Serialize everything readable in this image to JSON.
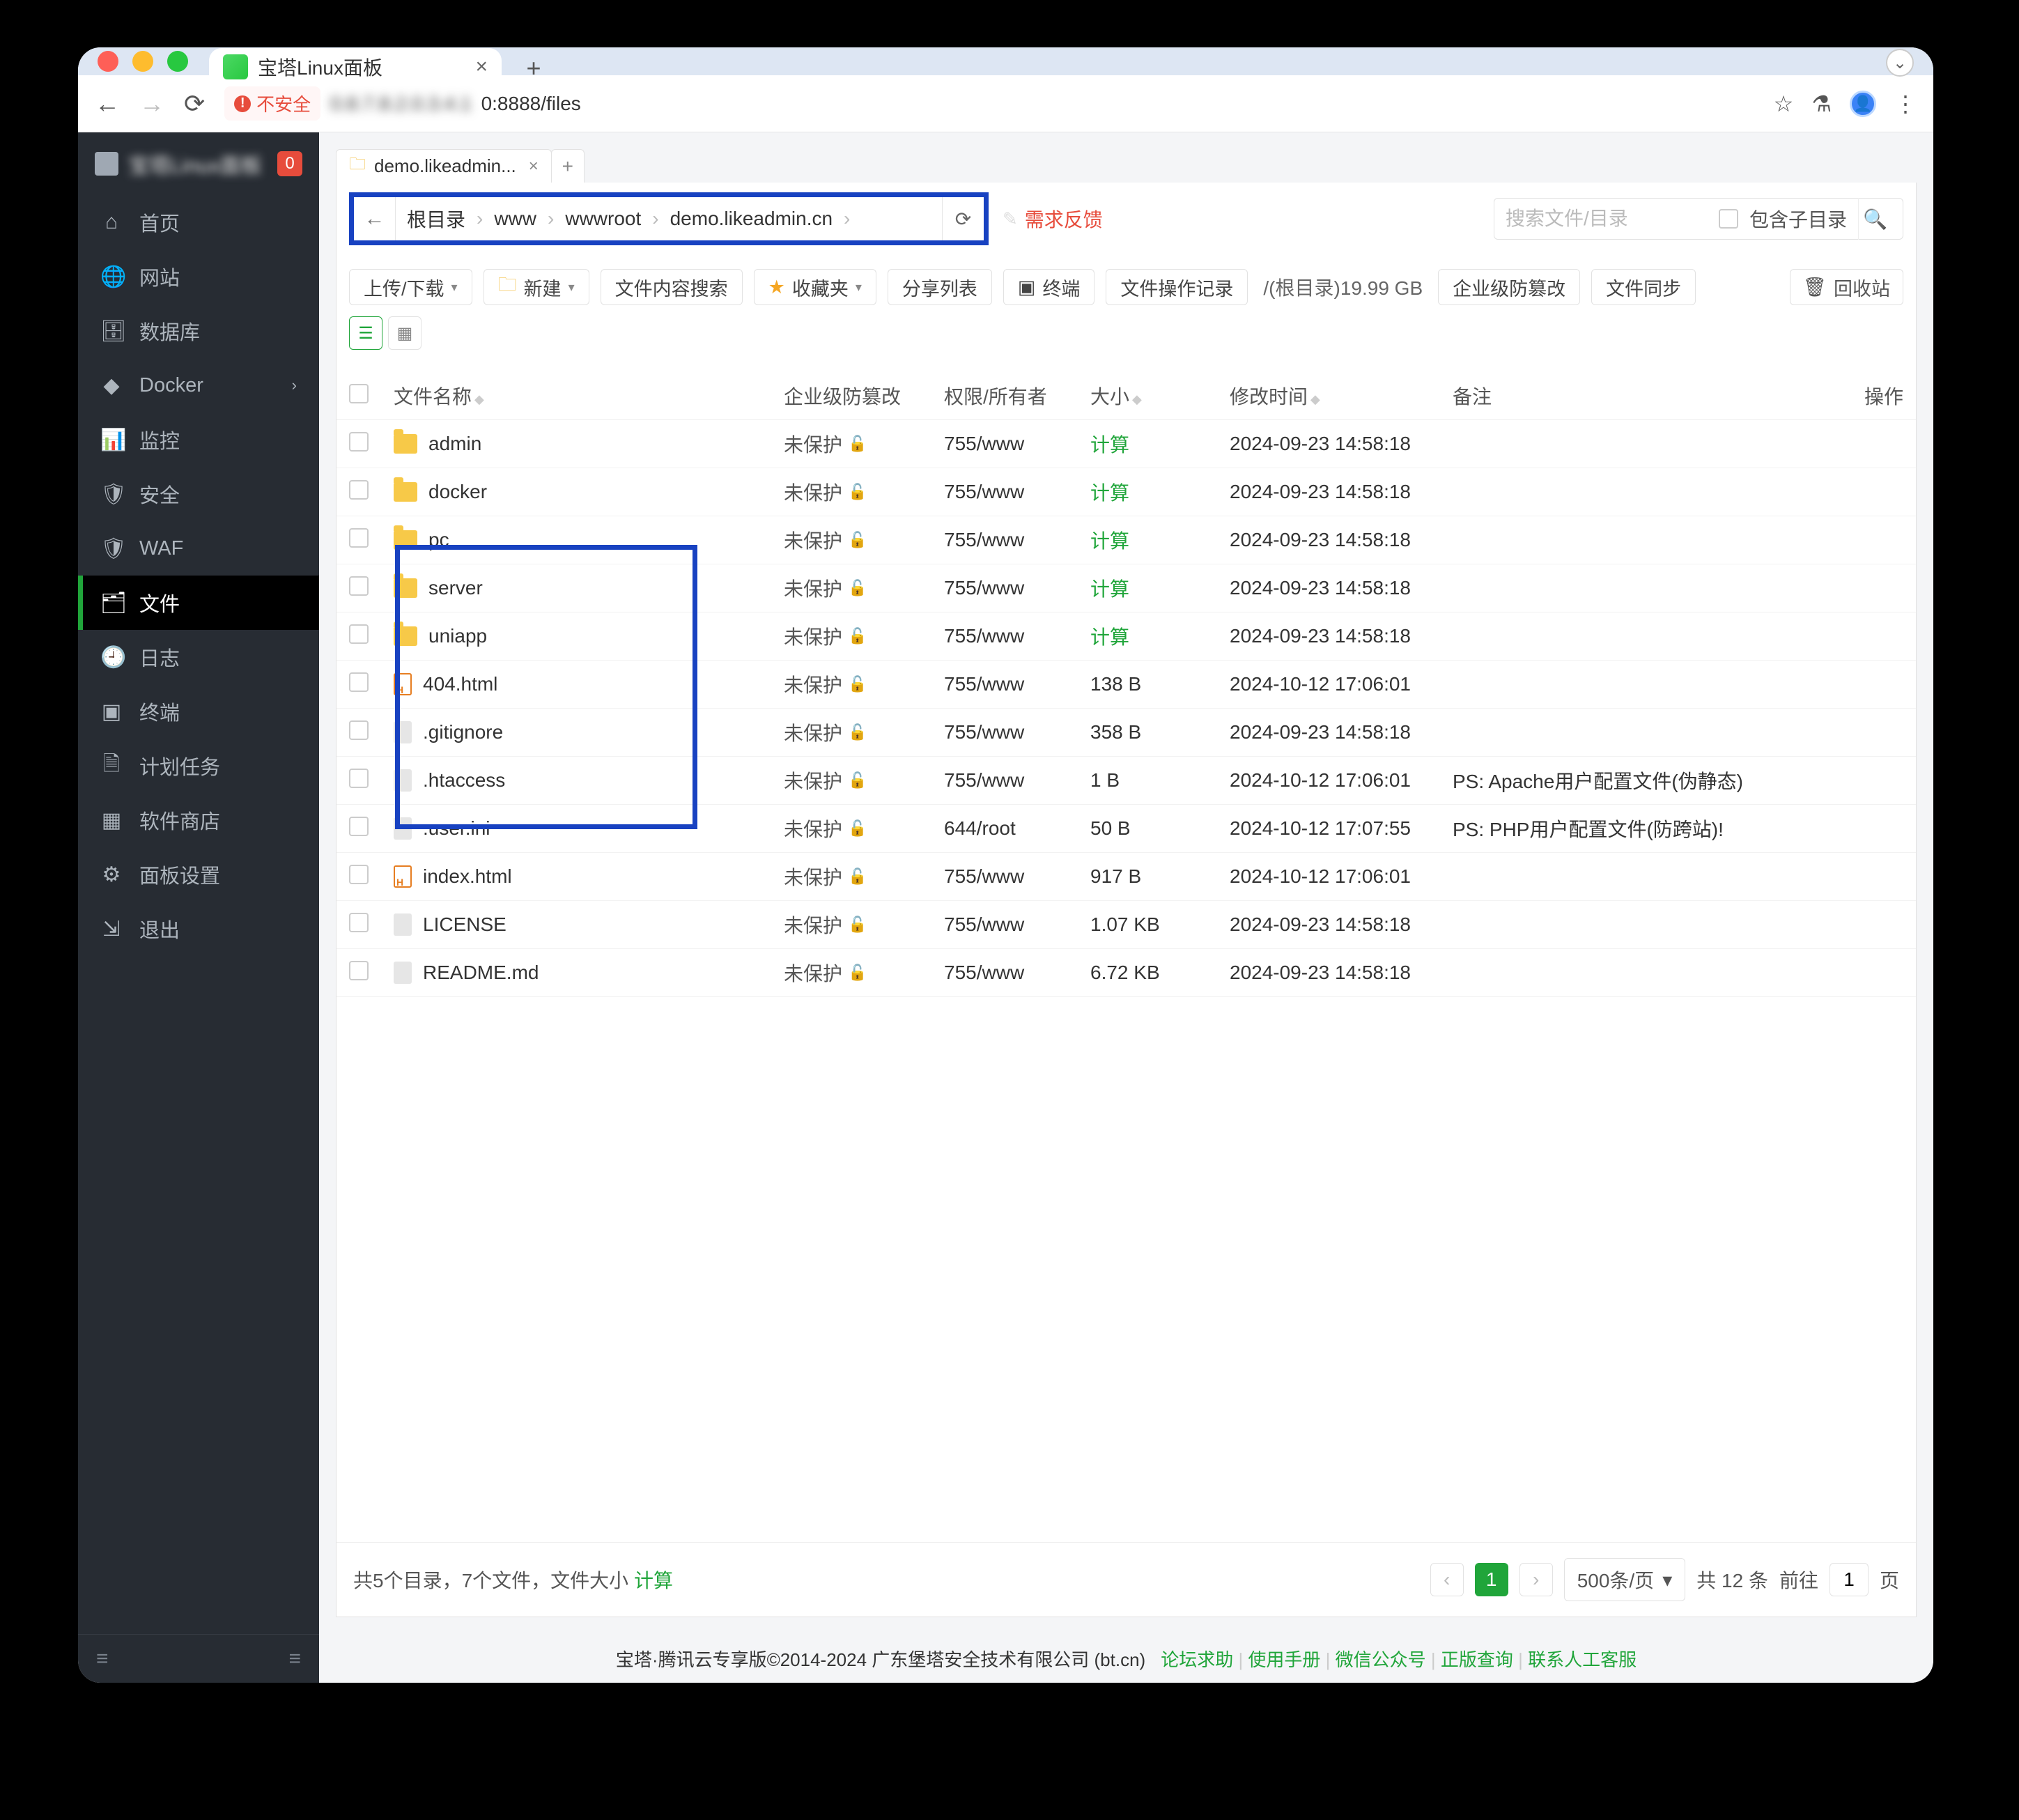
{
  "browser": {
    "tab_title": "宝塔Linux面板",
    "url_insecure": "不安全",
    "url_host_blur": "0.8.7.8.2.0.3.4.1",
    "url_rest": "0:8888/files",
    "new_tab": "+",
    "close": "×",
    "ext": "⌄"
  },
  "sidebar": {
    "brand": "宝塔Linux面板",
    "badge": "0",
    "items": [
      {
        "icon": "⌂",
        "label": "首页",
        "k": "home"
      },
      {
        "icon": "🌐",
        "label": "网站",
        "k": "site"
      },
      {
        "icon": "🗄",
        "label": "数据库",
        "k": "db"
      },
      {
        "icon": "◆",
        "label": "Docker",
        "k": "docker",
        "chev": true
      },
      {
        "icon": "📊",
        "label": "监控",
        "k": "mon"
      },
      {
        "icon": "🛡",
        "label": "安全",
        "k": "sec"
      },
      {
        "icon": "🛡",
        "label": "WAF",
        "k": "waf"
      },
      {
        "icon": "🗂",
        "label": "文件",
        "k": "files",
        "active": true
      },
      {
        "icon": "🕘",
        "label": "日志",
        "k": "log"
      },
      {
        "icon": "▣",
        "label": "终端",
        "k": "term"
      },
      {
        "icon": "🗎",
        "label": "计划任务",
        "k": "cron"
      },
      {
        "icon": "▦",
        "label": "软件商店",
        "k": "store"
      },
      {
        "icon": "⚙",
        "label": "面板设置",
        "k": "set"
      },
      {
        "icon": "⇲",
        "label": "退出",
        "k": "exit"
      }
    ],
    "footer_left": "≡",
    "footer_right": "≡"
  },
  "pathTab": {
    "label": "demo.likeadmin...",
    "close": "×",
    "add": "+"
  },
  "breadcrumb": {
    "back": "←",
    "parts": [
      "根目录",
      "www",
      "wwwroot",
      "demo.likeadmin.cn"
    ],
    "sep": "›",
    "reload": "⟳"
  },
  "feedback": {
    "icon": "✎",
    "text": "需求反馈"
  },
  "search": {
    "placeholder": "搜索文件/目录",
    "sub": "包含子目录",
    "icon": "🔍"
  },
  "toolbar": {
    "upload": "上传/下载",
    "new": "新建",
    "content_search": "文件内容搜索",
    "fav": "收藏夹",
    "share": "分享列表",
    "terminal": "终端",
    "oplog": "文件操作记录",
    "usage": "/(根目录)19.99 GB",
    "tamper": "企业级防篡改",
    "sync": "文件同步",
    "recycle": "回收站",
    "caret": "▾",
    "term_icon": "▣",
    "trash_icon": "🗑",
    "list_icon": "☰",
    "grid_icon": "▦"
  },
  "columns": {
    "name": "文件名称",
    "tamper": "企业级防篡改",
    "perm": "权限/所有者",
    "size": "大小",
    "mtime": "修改时间",
    "remark": "备注",
    "ops": "操作"
  },
  "rows": [
    {
      "type": "folder",
      "name": "admin",
      "tamper": "未保护",
      "perm": "755/www",
      "size": "计算",
      "size_calc": true,
      "mtime": "2024-09-23 14:58:18",
      "remark": ""
    },
    {
      "type": "folder",
      "name": "docker",
      "tamper": "未保护",
      "perm": "755/www",
      "size": "计算",
      "size_calc": true,
      "mtime": "2024-09-23 14:58:18",
      "remark": ""
    },
    {
      "type": "folder",
      "name": "pc",
      "tamper": "未保护",
      "perm": "755/www",
      "size": "计算",
      "size_calc": true,
      "mtime": "2024-09-23 14:58:18",
      "remark": ""
    },
    {
      "type": "folder",
      "name": "server",
      "tamper": "未保护",
      "perm": "755/www",
      "size": "计算",
      "size_calc": true,
      "mtime": "2024-09-23 14:58:18",
      "remark": ""
    },
    {
      "type": "folder",
      "name": "uniapp",
      "tamper": "未保护",
      "perm": "755/www",
      "size": "计算",
      "size_calc": true,
      "mtime": "2024-09-23 14:58:18",
      "remark": ""
    },
    {
      "type": "html",
      "name": "404.html",
      "tamper": "未保护",
      "perm": "755/www",
      "size": "138 B",
      "size_calc": false,
      "mtime": "2024-10-12 17:06:01",
      "remark": ""
    },
    {
      "type": "file",
      "name": ".gitignore",
      "tamper": "未保护",
      "perm": "755/www",
      "size": "358 B",
      "size_calc": false,
      "mtime": "2024-09-23 14:58:18",
      "remark": ""
    },
    {
      "type": "file",
      "name": ".htaccess",
      "tamper": "未保护",
      "perm": "755/www",
      "size": "1 B",
      "size_calc": false,
      "mtime": "2024-10-12 17:06:01",
      "remark": "PS: Apache用户配置文件(伪静态)"
    },
    {
      "type": "file",
      "name": ".user.ini",
      "tamper": "未保护",
      "perm": "644/root",
      "size": "50 B",
      "size_calc": false,
      "mtime": "2024-10-12 17:07:55",
      "remark": "PS: PHP用户配置文件(防跨站)!"
    },
    {
      "type": "html",
      "name": "index.html",
      "tamper": "未保护",
      "perm": "755/www",
      "size": "917 B",
      "size_calc": false,
      "mtime": "2024-10-12 17:06:01",
      "remark": ""
    },
    {
      "type": "file",
      "name": "LICENSE",
      "tamper": "未保护",
      "perm": "755/www",
      "size": "1.07 KB",
      "size_calc": false,
      "mtime": "2024-09-23 14:58:18",
      "remark": ""
    },
    {
      "type": "file",
      "name": "README.md",
      "tamper": "未保护",
      "perm": "755/www",
      "size": "6.72 KB",
      "size_calc": false,
      "mtime": "2024-09-23 14:58:18",
      "remark": ""
    }
  ],
  "summary": {
    "text": "共5个目录，7个文件，文件大小",
    "calc": "计算"
  },
  "pager": {
    "prev": "‹",
    "cur": "1",
    "next": "›",
    "per": "500条/页",
    "total": "共 12 条",
    "goto": "前往",
    "goto_val": "1",
    "unit": "页"
  },
  "bottom": {
    "copy": "宝塔·腾讯云专享版©2014-2024 广东堡塔安全技术有限公司 (bt.cn)",
    "links": [
      "论坛求助",
      "使用手册",
      "微信公众号",
      "正版查询",
      "联系人工客服"
    ],
    "sep": "|"
  }
}
